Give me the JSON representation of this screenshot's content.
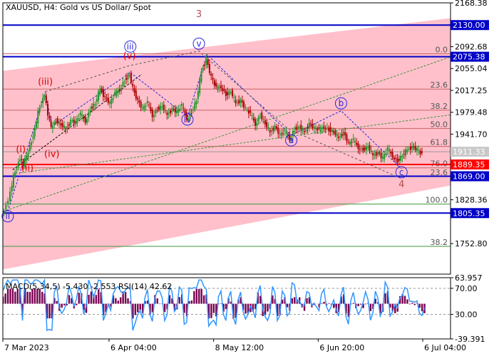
{
  "chart_data": {
    "type": "line",
    "title": "XAUUSD, H4:  Gold vs US Dollar/ Spot",
    "colors": {
      "frame": "#000000",
      "channel_fill": "#ffc0cb",
      "fib_line": "#c86464",
      "level_blue": "#0000c8",
      "level_red": "#ff0000",
      "level_green": "#3c963c",
      "wave_red": "#dc0000",
      "wave_blue": "#2828dc",
      "bull": "#1e9628",
      "bear": "#aa0000",
      "macd_hist": "#780050",
      "rsi": "#3296ff"
    },
    "price_axis": {
      "ylim": [
        1700,
        2168.38
      ],
      "ticks": [
        "2168.38",
        "2092.68",
        "2055.04",
        "2017.25",
        "1979.48",
        "1941.70",
        "1828.36",
        "1752.80"
      ],
      "tick_values": [
        2168.38,
        2092.68,
        2055.04,
        2017.25,
        1979.48,
        1941.7,
        1828.36,
        1752.8
      ]
    },
    "levels": [
      {
        "label": "2130.00",
        "value": 2130.0,
        "kind": "blue"
      },
      {
        "label": "2075.38",
        "value": 2075.38,
        "kind": "blue"
      },
      {
        "label": "1889.35",
        "value": 1889.35,
        "kind": "red"
      },
      {
        "label": "1869.00",
        "value": 1869.0,
        "kind": "blue"
      },
      {
        "label": "1805.35",
        "value": 1805.35,
        "kind": "blue"
      }
    ],
    "current_price": {
      "label": "1911.33",
      "value": 1911.33
    },
    "fib_levels": [
      {
        "label": "0.0",
        "value": 2080.5
      },
      {
        "label": "23.6",
        "value": 2019.5
      },
      {
        "label": "38.2",
        "value": 1983.0
      },
      {
        "label": "50.0",
        "value": 1951.5
      },
      {
        "label": "61.8",
        "value": 1920.5
      },
      {
        "label": "76.0",
        "value": 1883.5
      },
      {
        "label": "23.6",
        "value": 1868.5
      },
      {
        "label": "100.0",
        "value": 1821.0
      },
      {
        "label": "38.2",
        "value": 1748.0
      }
    ],
    "x_axis": {
      "ticks": [
        "7 Mar 2023",
        "6 Apr 04:00",
        "8 May 12:00",
        "6 Jun 20:00",
        "6 Jul 04:00"
      ],
      "tick_bars": [
        0,
        130,
        258,
        386,
        514
      ]
    },
    "price_series": {
      "x": [
        0,
        5,
        10,
        14,
        18,
        22,
        26,
        30,
        36,
        40,
        44,
        48,
        52,
        56,
        60,
        66,
        72,
        78,
        84,
        90,
        96,
        102,
        108,
        114,
        120,
        126,
        132,
        138,
        144,
        150,
        156,
        160,
        166,
        172,
        178,
        184,
        190,
        196,
        202,
        208,
        214,
        220,
        226,
        232,
        238,
        244,
        250,
        256,
        262,
        268,
        274,
        280,
        286,
        292,
        298,
        304,
        310,
        316,
        322,
        328,
        334,
        340,
        346,
        352,
        358,
        364,
        370,
        376,
        382,
        388,
        394,
        400,
        406,
        412,
        418,
        424,
        430,
        436,
        442,
        448,
        454,
        460,
        466,
        472,
        478,
        484,
        490,
        496,
        502,
        508,
        514
      ],
      "y": [
        1808,
        1818,
        1840,
        1868,
        1885,
        1900,
        1888,
        1905,
        1930,
        1950,
        1978,
        1995,
        2010,
        1975,
        1955,
        1965,
        1958,
        1950,
        1965,
        1962,
        1975,
        1965,
        1985,
        1995,
        2020,
        2005,
        1995,
        2010,
        2020,
        2035,
        2045,
        2020,
        2000,
        1985,
        1995,
        1975,
        1985,
        1990,
        1975,
        1985,
        1980,
        1990,
        1970,
        1980,
        2000,
        2050,
        2070,
        2040,
        2020,
        2025,
        2010,
        2015,
        1995,
        2000,
        1985,
        1975,
        1960,
        1975,
        1960,
        1945,
        1955,
        1940,
        1945,
        1935,
        1950,
        1955,
        1945,
        1960,
        1952,
        1948,
        1955,
        1950,
        1945,
        1935,
        1945,
        1925,
        1930,
        1920,
        1915,
        1920,
        1905,
        1910,
        1900,
        1915,
        1905,
        1895,
        1905,
        1915,
        1920,
        1915,
        1905
      ]
    },
    "wave_labels_red": [
      {
        "label": "ii",
        "bar": 30,
        "price": 1878
      },
      {
        "label": "i",
        "bar": 22,
        "price": 1910
      },
      {
        "label": "iv",
        "bar": 60,
        "price": 1902
      },
      {
        "label": "iii",
        "bar": 52,
        "price": 2027
      },
      {
        "label": "v",
        "bar": 155,
        "price": 2072
      },
      {
        "label": "3",
        "bar": 240,
        "price": 2144
      },
      {
        "label": "4",
        "bar": 488,
        "price": 1850
      }
    ],
    "wave_labels_blue": [
      {
        "label": "ii",
        "bar": 6,
        "price": 1795
      },
      {
        "label": "iii",
        "bar": 156,
        "price": 2088
      },
      {
        "label": "iv",
        "bar": 226,
        "price": 1962
      },
      {
        "label": "v",
        "bar": 240,
        "price": 2093
      },
      {
        "label": "a",
        "bar": 353,
        "price": 1926
      },
      {
        "label": "b",
        "bar": 414,
        "price": 1990
      },
      {
        "label": "c",
        "bar": 488,
        "price": 1871
      }
    ],
    "indicator": {
      "label": "MACD(5,34,5) -5.430 -2.553 RSI(14) 42.62",
      "ylim": [
        -39.391,
        63.957
      ],
      "ticks": [
        "63.957",
        "70.00",
        "30.00",
        "-39.391"
      ],
      "tick_values": [
        63.957,
        46.0,
        2.0,
        -39.391
      ],
      "rsi_levels": [
        46.0,
        2.0
      ]
    }
  }
}
